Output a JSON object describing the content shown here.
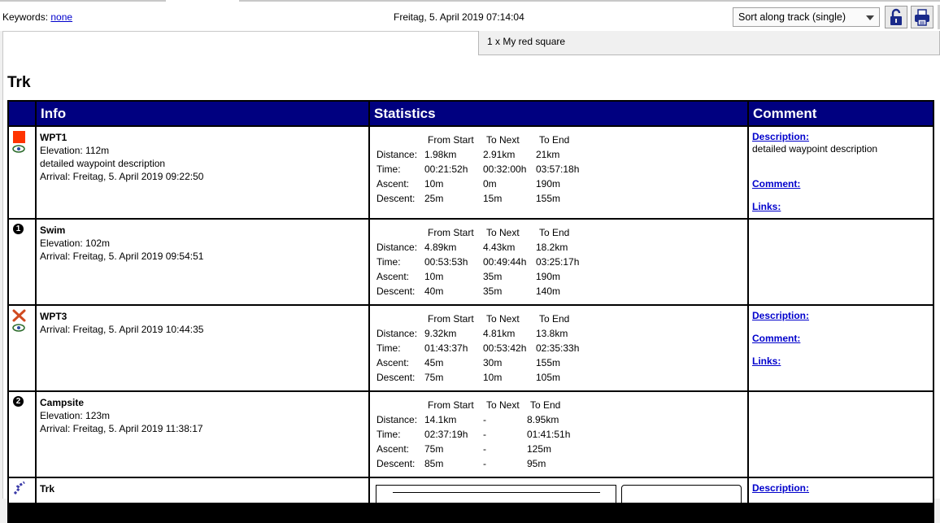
{
  "toolbar": {
    "keywords_label": "Keywords:",
    "keywords_value": "none",
    "datetime": "Freitag, 5. April 2019 07:14:04",
    "sort_value": "Sort along track (single)"
  },
  "legend": {
    "text": "1 x My red square"
  },
  "page_title": "Trk",
  "table": {
    "headers": {
      "info": "Info",
      "statistics": "Statistics",
      "comment": "Comment"
    },
    "stat_labels": {
      "distance": "Distance:",
      "time": "Time:",
      "ascent": "Ascent:",
      "descent": "Descent:"
    },
    "rows": [
      {
        "name": "WPT1",
        "lines": [
          "Elevation: 112m",
          "detailed waypoint description",
          "Arrival: Freitag, 5. April 2019 09:22:50"
        ],
        "icon": "red-square-icon",
        "stats": {
          "from_start_label": "From Start",
          "to_next_label": "To Next",
          "to_end_label": "To End",
          "distance": [
            "1.98km",
            "2.91km",
            "21km"
          ],
          "time": [
            "00:21:52h",
            "00:32:00h",
            "03:57:18h"
          ],
          "ascent": [
            "10m",
            "0m",
            "190m"
          ],
          "descent": [
            "25m",
            "15m",
            "155m"
          ]
        },
        "comment": {
          "description_label": "Description:",
          "description_text": "detailed waypoint description",
          "comment_label": "Comment:",
          "links_label": "Links:"
        }
      },
      {
        "name": "Swim",
        "lines": [
          "Elevation: 102m",
          "Arrival: Freitag, 5. April 2019 09:54:51"
        ],
        "icon": "number-1-icon",
        "icon_text": "1",
        "stats": {
          "from_start_label": "From Start",
          "to_next_label": "To Next",
          "to_end_label": "To End",
          "distance": [
            "4.89km",
            "4.43km",
            "18.2km"
          ],
          "time": [
            "00:53:53h",
            "00:49:44h",
            "03:25:17h"
          ],
          "ascent": [
            "10m",
            "35m",
            "190m"
          ],
          "descent": [
            "40m",
            "35m",
            "140m"
          ]
        }
      },
      {
        "name": "WPT3",
        "lines": [
          "Arrival: Freitag, 5. April 2019 10:44:35"
        ],
        "icon": "crossed-tools-icon",
        "stats": {
          "from_start_label": "From Start",
          "to_next_label": "To Next",
          "to_end_label": "To End",
          "distance": [
            "9.32km",
            "4.81km",
            "13.8km"
          ],
          "time": [
            "01:43:37h",
            "00:53:42h",
            "02:35:33h"
          ],
          "ascent": [
            "45m",
            "30m",
            "155m"
          ],
          "descent": [
            "75m",
            "10m",
            "105m"
          ]
        },
        "comment": {
          "description_label": "Description:",
          "comment_label": "Comment:",
          "links_label": "Links:"
        }
      },
      {
        "name": "Campsite",
        "lines": [
          "Elevation: 123m",
          "Arrival: Freitag, 5. April 2019 11:38:17"
        ],
        "icon": "number-2-icon",
        "icon_text": "2",
        "stats": {
          "from_start_label": "From Start",
          "to_next_label": "To Next",
          "to_end_label": "To End",
          "distance": [
            "14.1km",
            "-",
            "8.95km"
          ],
          "time": [
            "02:37:19h",
            "-",
            "01:41:51h"
          ],
          "ascent": [
            "75m",
            "-",
            "125m"
          ],
          "descent": [
            "85m",
            "-",
            "95m"
          ]
        }
      },
      {
        "name": "Trk",
        "icon": "track-icon",
        "comment": {
          "description_label": "Description:"
        }
      }
    ]
  }
}
